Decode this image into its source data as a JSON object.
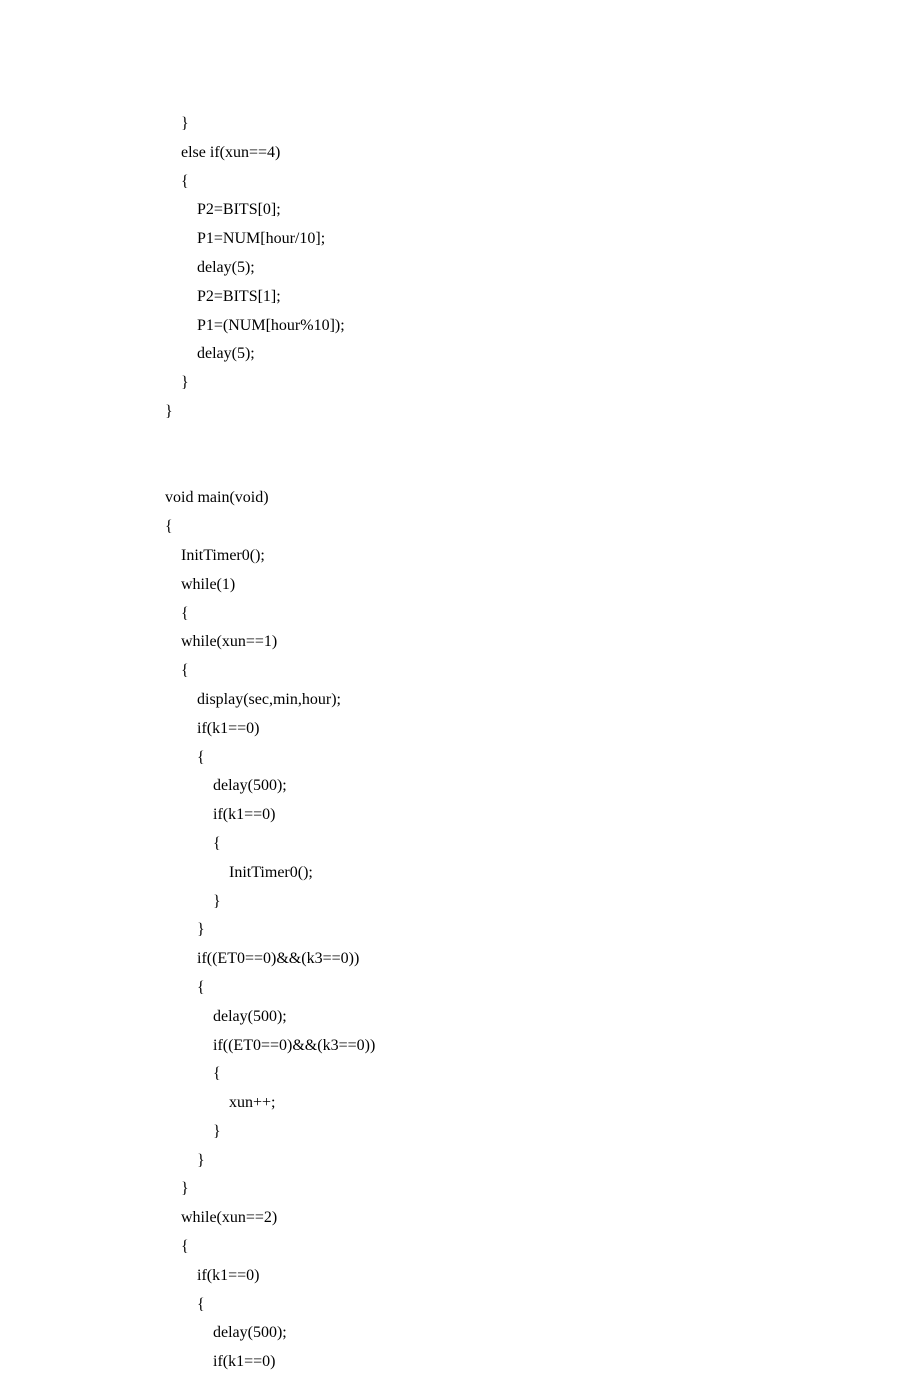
{
  "lines": [
    "    }",
    "    else if(xun==4)",
    "    {",
    "        P2=BITS[0];",
    "        P1=NUM[hour/10];",
    "        delay(5);",
    "        P2=BITS[1];",
    "        P1=(NUM[hour%10]);",
    "        delay(5);",
    "    }",
    "}",
    "",
    "",
    "void main(void)",
    "{",
    "    InitTimer0();",
    "    while(1)",
    "    {",
    "    while(xun==1)",
    "    {",
    "        display(sec,min,hour);",
    "        if(k1==0)",
    "        {",
    "            delay(500);",
    "            if(k1==0)",
    "            {",
    "                InitTimer0();",
    "            }",
    "        }",
    "        if((ET0==0)&&(k3==0))",
    "        {",
    "            delay(500);",
    "            if((ET0==0)&&(k3==0))",
    "            {",
    "                xun++;",
    "            }",
    "        }",
    "    }",
    "    while(xun==2)",
    "    {",
    "        if(k1==0)",
    "        {",
    "            delay(500);",
    "            if(k1==0)"
  ]
}
